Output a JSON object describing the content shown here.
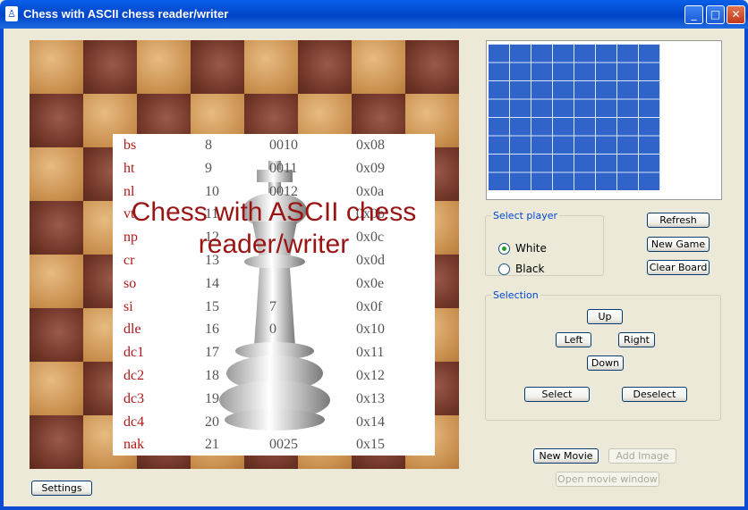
{
  "window": {
    "title": "Chess with ASCII chess reader/writer",
    "icon": "chess-pawn-icon"
  },
  "board": {
    "overlay_title": "Chess with ASCII chess reader/writer",
    "ascii_rows": [
      [
        "bs",
        "8",
        "0010",
        "0x08"
      ],
      [
        "ht",
        "9",
        "0011",
        "0x09"
      ],
      [
        "nl",
        "10",
        "0012",
        "0x0a"
      ],
      [
        "vt",
        "11",
        "",
        "0x0b"
      ],
      [
        "np",
        "12",
        "",
        "0x0c"
      ],
      [
        "cr",
        "13",
        "",
        "0x0d"
      ],
      [
        "so",
        "14",
        "",
        "0x0e"
      ],
      [
        "si",
        "15",
        "7",
        "0x0f"
      ],
      [
        "dle",
        "16",
        "0",
        "0x10"
      ],
      [
        "dc1",
        "17",
        "",
        "0x11"
      ],
      [
        "dc2",
        "18",
        "",
        "0x12"
      ],
      [
        "dc3",
        "19",
        "",
        "0x13"
      ],
      [
        "dc4",
        "20",
        "",
        "0x14"
      ],
      [
        "nak",
        "21",
        "0025",
        "0x15"
      ]
    ]
  },
  "select_player": {
    "legend": "Select player",
    "options": [
      "White",
      "Black"
    ],
    "selected": "White"
  },
  "actions": {
    "refresh": "Refresh",
    "new_game": "New Game",
    "clear_board": "Clear Board"
  },
  "selection": {
    "legend": "Selection",
    "up": "Up",
    "left": "Left",
    "right": "Right",
    "down": "Down",
    "select": "Select",
    "deselect": "Deselect"
  },
  "movie": {
    "new_movie": "New Movie",
    "add_image": "Add Image",
    "open_window": "Open movie window"
  },
  "settings": "Settings",
  "colors": {
    "title_bar": "#0045C8",
    "accent_text": "#B01818",
    "preview_grid": "#3064C8"
  }
}
